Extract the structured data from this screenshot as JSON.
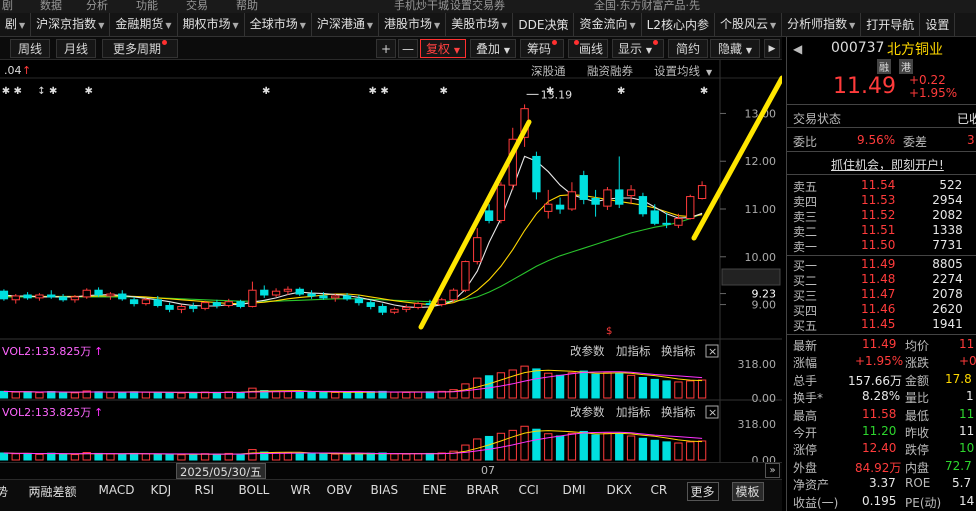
{
  "topbar": [
    "剧",
    "数据",
    "分析",
    "功能",
    "交易",
    "帮助",
    "手机炒干城",
    "设置交易券",
    "全国·东方财富产品·先"
  ],
  "nav": [
    {
      "label": "剧",
      "arrow": true
    },
    {
      "label": "沪深京指数",
      "arrow": true
    },
    {
      "label": "金融期货",
      "arrow": true
    },
    {
      "label": "期权市场",
      "arrow": true
    },
    {
      "label": "全球市场",
      "arrow": true
    },
    {
      "label": "沪深港通",
      "arrow": true
    },
    {
      "label": "港股市场",
      "arrow": true
    },
    {
      "label": "美股市场",
      "arrow": true
    },
    {
      "label": "DDE决策",
      "arrow": false
    },
    {
      "label": "资金流向",
      "arrow": true
    },
    {
      "label": "L2核心内参",
      "arrow": false
    },
    {
      "label": "个股风云",
      "arrow": true
    },
    {
      "label": "分析师指数",
      "arrow": true
    },
    {
      "label": "打开导航",
      "arrow": false
    },
    {
      "label": "设置",
      "arrow": false
    }
  ],
  "toolbar": {
    "week": "周线",
    "month": "月线",
    "more_period": "更多周期",
    "plus": "+",
    "minus": "—",
    "fq": "复权",
    "overlay": "叠加",
    "chips": "筹码",
    "draw": "画线",
    "display": "显示",
    "simple": "简约",
    "hide": "隐藏",
    "collapse": "▶"
  },
  "chart": {
    "ma_value": ".04",
    "deep_link": "深股通",
    "margin": "融资融券",
    "ma_setting": "设置均线",
    "peak_label": "13.19",
    "s_mark": "$",
    "price_ticks": [
      "13.00",
      "12.00",
      "11.00",
      "10.00",
      "9.23",
      "9.00"
    ],
    "vol_label": "VOL2:133.825万",
    "vol_change": "改参数",
    "vol_add": "加指标",
    "vol_switch": "换指标",
    "vol_close": "×",
    "vol_ticks": [
      "318.00",
      "0.00"
    ],
    "colors": {
      "up": "#ff3b3b",
      "down": "#00e0e0",
      "ma_white": "#e6e6e6",
      "ma_yellow": "#ffd700",
      "ma_green": "#29c32c",
      "vol_ma": "#ff33ff",
      "trend": "#ffe600"
    }
  },
  "chart_data": {
    "type": "candlestick",
    "title": "",
    "xlabel": "",
    "ylabel": "",
    "ylim": [
      8.3,
      13.7
    ],
    "x_ticks": [
      "2025/05/30/五",
      "07"
    ],
    "ohlc": [
      [
        9.28,
        9.32,
        9.08,
        9.12
      ],
      [
        9.1,
        9.22,
        9.02,
        9.18
      ],
      [
        9.2,
        9.26,
        9.1,
        9.14
      ],
      [
        9.14,
        9.24,
        9.08,
        9.2
      ],
      [
        9.2,
        9.3,
        9.12,
        9.16
      ],
      [
        9.16,
        9.22,
        9.06,
        9.1
      ],
      [
        9.1,
        9.2,
        9.04,
        9.16
      ],
      [
        9.16,
        9.34,
        9.12,
        9.3
      ],
      [
        9.3,
        9.36,
        9.16,
        9.2
      ],
      [
        9.18,
        9.26,
        9.1,
        9.22
      ],
      [
        9.22,
        9.3,
        9.08,
        9.12
      ],
      [
        9.1,
        9.16,
        8.96,
        9.02
      ],
      [
        9.02,
        9.14,
        8.98,
        9.1
      ],
      [
        9.1,
        9.18,
        8.94,
        8.98
      ],
      [
        8.98,
        9.04,
        8.84,
        8.9
      ],
      [
        8.9,
        9.0,
        8.82,
        8.96
      ],
      [
        8.96,
        9.04,
        8.84,
        8.92
      ],
      [
        8.92,
        9.08,
        8.88,
        9.04
      ],
      [
        9.04,
        9.1,
        8.92,
        8.98
      ],
      [
        8.98,
        9.12,
        8.94,
        9.06
      ],
      [
        9.06,
        9.1,
        8.92,
        8.96
      ],
      [
        8.96,
        9.48,
        8.94,
        9.3
      ],
      [
        9.3,
        9.4,
        9.14,
        9.2
      ],
      [
        9.2,
        9.34,
        9.16,
        9.28
      ],
      [
        9.28,
        9.38,
        9.2,
        9.32
      ],
      [
        9.32,
        9.36,
        9.18,
        9.22
      ],
      [
        9.22,
        9.3,
        9.12,
        9.18
      ],
      [
        9.18,
        9.26,
        9.1,
        9.14
      ],
      [
        9.14,
        9.22,
        9.06,
        9.18
      ],
      [
        9.18,
        9.24,
        9.08,
        9.12
      ],
      [
        9.12,
        9.2,
        8.98,
        9.04
      ],
      [
        9.04,
        9.1,
        8.9,
        8.96
      ],
      [
        8.96,
        9.02,
        8.78,
        8.84
      ],
      [
        8.84,
        8.94,
        8.8,
        8.9
      ],
      [
        8.9,
        9.0,
        8.84,
        8.94
      ],
      [
        8.94,
        9.06,
        8.9,
        9.02
      ],
      [
        9.02,
        9.1,
        8.94,
        9.0
      ],
      [
        9.0,
        9.14,
        8.96,
        9.1
      ],
      [
        9.1,
        9.34,
        9.04,
        9.3
      ],
      [
        9.3,
        9.92,
        9.26,
        9.9
      ],
      [
        9.9,
        10.6,
        9.84,
        10.4
      ],
      [
        10.96,
        11.1,
        10.7,
        10.76
      ],
      [
        10.76,
        11.56,
        10.7,
        11.5
      ],
      [
        11.5,
        12.7,
        11.4,
        12.46
      ],
      [
        12.5,
        13.19,
        12.3,
        13.1
      ],
      [
        12.1,
        12.2,
        11.2,
        11.36
      ],
      [
        10.95,
        11.4,
        10.8,
        11.1
      ],
      [
        11.08,
        11.24,
        10.9,
        11.0
      ],
      [
        11.0,
        11.56,
        10.96,
        11.36
      ],
      [
        11.7,
        11.8,
        11.1,
        11.2
      ],
      [
        11.22,
        11.4,
        10.84,
        11.1
      ],
      [
        11.06,
        11.46,
        10.98,
        11.4
      ],
      [
        11.4,
        12.1,
        11.02,
        11.1
      ],
      [
        11.28,
        11.5,
        11.1,
        11.4
      ],
      [
        11.26,
        11.34,
        10.84,
        10.9
      ],
      [
        10.96,
        11.1,
        10.66,
        10.7
      ],
      [
        10.7,
        10.92,
        10.6,
        10.68
      ],
      [
        10.66,
        10.9,
        10.6,
        10.8
      ],
      [
        10.8,
        11.3,
        10.78,
        11.26
      ],
      [
        11.22,
        11.58,
        11.2,
        11.49
      ]
    ],
    "volume": [
      62,
      55,
      58,
      50,
      60,
      52,
      48,
      66,
      58,
      54,
      50,
      58,
      55,
      52,
      48,
      46,
      50,
      56,
      52,
      58,
      50,
      92,
      70,
      64,
      62,
      58,
      56,
      54,
      52,
      50,
      56,
      60,
      62,
      54,
      52,
      56,
      58,
      62,
      78,
      132,
      186,
      208,
      236,
      262,
      298,
      272,
      232,
      212,
      236,
      252,
      222,
      236,
      232,
      212,
      192,
      174,
      160,
      150,
      160,
      168
    ],
    "vol_ylim": [
      0,
      318
    ],
    "ma_white": [
      9.2,
      9.18,
      9.18,
      9.16,
      9.16,
      9.16,
      9.16,
      9.19,
      9.2,
      9.21,
      9.19,
      9.16,
      9.13,
      9.1,
      9.06,
      9.01,
      8.98,
      8.97,
      8.97,
      9.0,
      9.0,
      9.05,
      9.09,
      9.14,
      9.21,
      9.26,
      9.24,
      9.23,
      9.21,
      9.19,
      9.15,
      9.1,
      9.05,
      8.99,
      8.95,
      8.94,
      8.95,
      9.0,
      9.08,
      9.32,
      9.7,
      10.3,
      10.8,
      11.44,
      12.1,
      12.0,
      11.78,
      11.5,
      11.3,
      11.22,
      11.15,
      11.21,
      11.23,
      11.23,
      11.18,
      11.04,
      10.9,
      10.81,
      10.82,
      10.91
    ],
    "ma_yellow": [
      9.18,
      9.18,
      9.18,
      9.17,
      9.17,
      9.17,
      9.17,
      9.17,
      9.18,
      9.18,
      9.18,
      9.17,
      9.16,
      9.14,
      9.12,
      9.1,
      9.08,
      9.06,
      9.04,
      9.02,
      9.02,
      9.03,
      9.05,
      9.08,
      9.12,
      9.15,
      9.17,
      9.2,
      9.22,
      9.22,
      9.2,
      9.16,
      9.12,
      9.08,
      9.05,
      9.02,
      9.0,
      9.0,
      9.04,
      9.14,
      9.3,
      9.52,
      9.8,
      10.15,
      10.55,
      10.9,
      11.16,
      11.28,
      11.3,
      11.28,
      11.24,
      11.2,
      11.16,
      11.12,
      11.08,
      11.02,
      10.94,
      10.86,
      10.84,
      10.88
    ],
    "ma_green": [
      9.16,
      9.16,
      9.16,
      9.16,
      9.16,
      9.16,
      9.16,
      9.16,
      9.16,
      9.16,
      9.16,
      9.16,
      9.15,
      9.14,
      9.13,
      9.12,
      9.11,
      9.1,
      9.09,
      9.08,
      9.07,
      9.07,
      9.07,
      9.07,
      9.08,
      9.09,
      9.1,
      9.11,
      9.12,
      9.12,
      9.12,
      9.11,
      9.1,
      9.09,
      9.08,
      9.07,
      9.06,
      9.06,
      9.07,
      9.1,
      9.16,
      9.26,
      9.38,
      9.52,
      9.66,
      9.8,
      9.92,
      10.02,
      10.1,
      10.18,
      10.26,
      10.34,
      10.42,
      10.5,
      10.56,
      10.62,
      10.66,
      10.72,
      10.8,
      10.9
    ]
  },
  "date_bar": {
    "date": "2025/05/30/五",
    "month": "07"
  },
  "indicators": [
    "势",
    "两融差额",
    "MACD",
    "KDJ",
    "RSI",
    "BOLL",
    "WR",
    "OBV",
    "BIAS",
    "ENE",
    "BRAR",
    "CCI",
    "DMI",
    "DKX",
    "CR",
    "更多",
    "模板"
  ],
  "stock": {
    "code": "000737",
    "name": "北方铜业",
    "badge1": "融",
    "badge2": "港",
    "price": "11.49",
    "change": "+0.22",
    "change_pct": "+1.95%",
    "trade_status_label": "交易状态",
    "trade_status": "已收",
    "ratio_label": "委比",
    "ratio": "9.56%",
    "diff_label": "委差",
    "diff": "3",
    "ad": "抓住机会，即刻开户!",
    "asks": [
      {
        "label": "卖五",
        "price": "11.54",
        "vol": "522"
      },
      {
        "label": "卖四",
        "price": "11.53",
        "vol": "2954"
      },
      {
        "label": "卖三",
        "price": "11.52",
        "vol": "2082"
      },
      {
        "label": "卖二",
        "price": "11.51",
        "vol": "1338"
      },
      {
        "label": "卖一",
        "price": "11.50",
        "vol": "7731"
      }
    ],
    "bids": [
      {
        "label": "买一",
        "price": "11.49",
        "vol": "8805"
      },
      {
        "label": "买二",
        "price": "11.48",
        "vol": "2274"
      },
      {
        "label": "买三",
        "price": "11.47",
        "vol": "2078"
      },
      {
        "label": "买四",
        "price": "11.46",
        "vol": "2620"
      },
      {
        "label": "买五",
        "price": "11.45",
        "vol": "1941"
      }
    ],
    "stats": [
      {
        "l1": "最新",
        "v1": "11.49",
        "c1": "red",
        "l2": "均价",
        "v2": "11",
        "c2": "red"
      },
      {
        "l1": "涨幅",
        "v1": "+1.95%",
        "c1": "red",
        "l2": "涨跌",
        "v2": "+0",
        "c2": "red"
      },
      {
        "l1": "总手",
        "v1": "157.66万",
        "c1": "wht",
        "l2": "金额",
        "v2": "17.8",
        "c2": "yel"
      },
      {
        "l1": "换手*",
        "v1": "8.28%",
        "c1": "wht",
        "l2": "量比",
        "v2": "1",
        "c2": "wht"
      },
      {
        "l1": "最高",
        "v1": "11.58",
        "c1": "red",
        "l2": "最低",
        "v2": "11",
        "c2": "grn"
      },
      {
        "l1": "今开",
        "v1": "11.20",
        "c1": "grn",
        "l2": "昨收",
        "v2": "11",
        "c2": "wht"
      },
      {
        "l1": "涨停",
        "v1": "12.40",
        "c1": "red",
        "l2": "跌停",
        "v2": "10",
        "c2": "grn"
      },
      {
        "l1": "外盘",
        "v1": "84.92万",
        "c1": "red",
        "l2": "内盘",
        "v2": "72.7",
        "c2": "grn"
      },
      {
        "l1": "净资产",
        "v1": "3.37",
        "c1": "wht",
        "l2": "ROE",
        "v2": "5.7",
        "c2": "wht"
      },
      {
        "l1": "收益(一)",
        "v1": "0.195",
        "c1": "wht",
        "l2": "PE(动)",
        "v2": "14",
        "c2": "wht"
      }
    ]
  }
}
